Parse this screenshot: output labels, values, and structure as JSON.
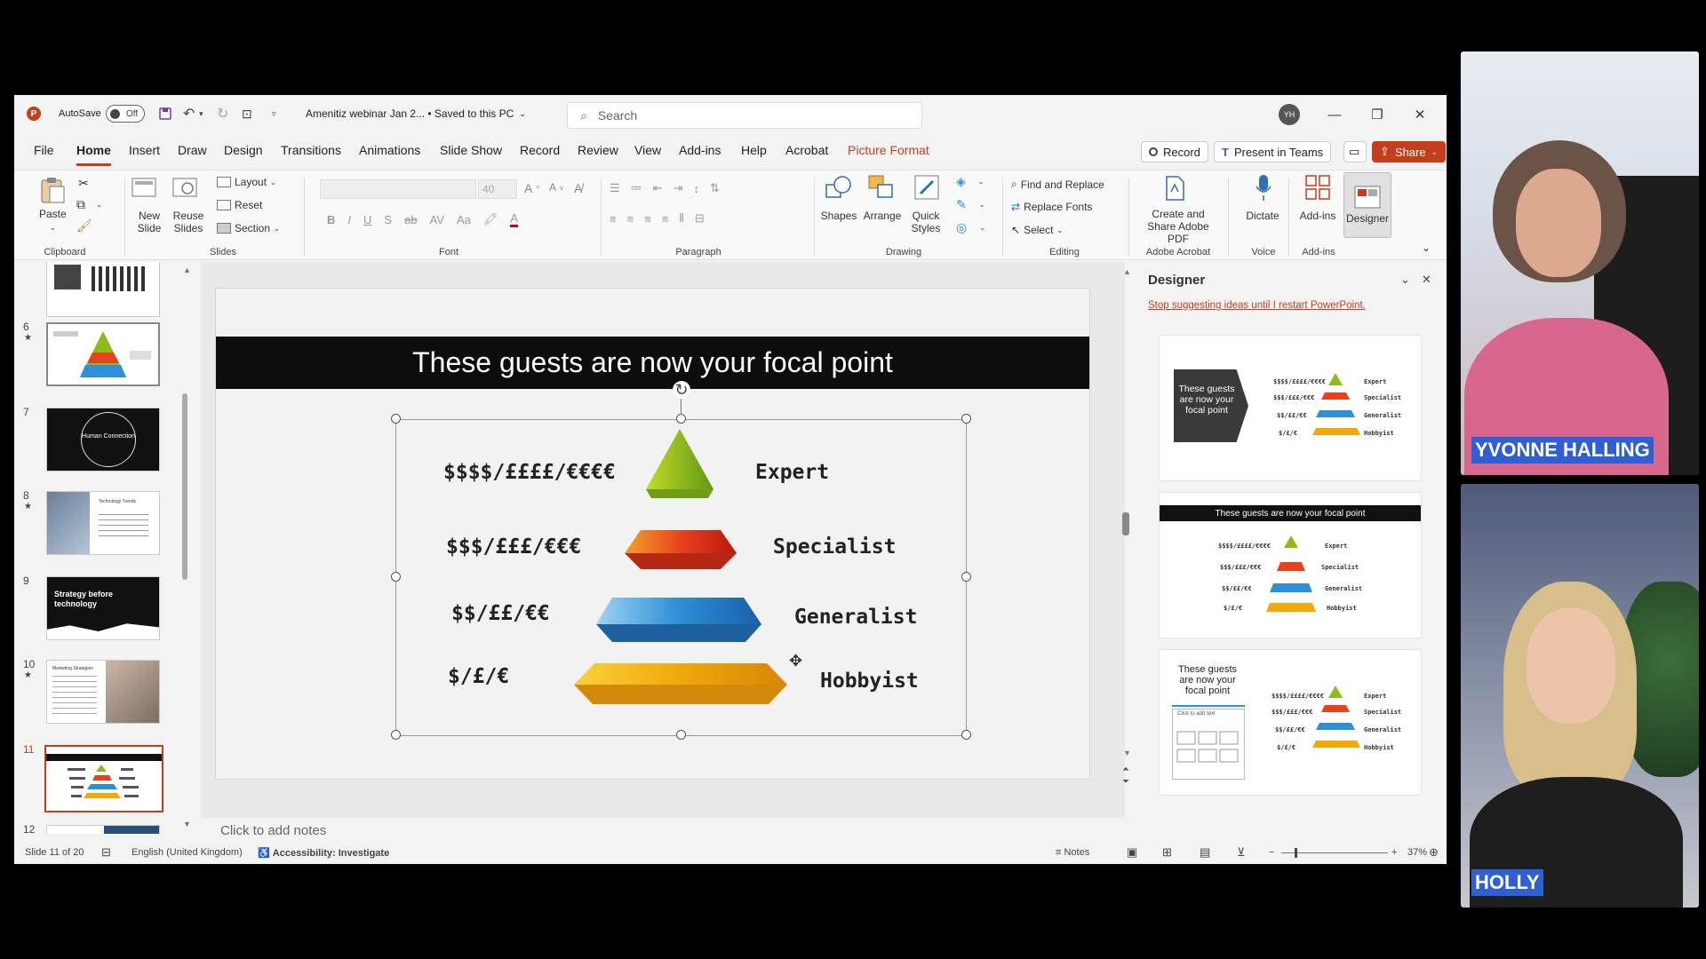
{
  "window": {
    "autosave_label": "AutoSave",
    "autosave_state": "Off",
    "doc_title": "Amenitiz webinar Jan 2... • Saved to this PC",
    "search_placeholder": "Search",
    "avatar_initials": "YH"
  },
  "tabs": [
    "File",
    "Home",
    "Insert",
    "Draw",
    "Design",
    "Transitions",
    "Animations",
    "Slide Show",
    "Record",
    "Review",
    "View",
    "Add-ins",
    "Help",
    "Acrobat",
    "Picture Format"
  ],
  "active_tab": "Home",
  "top_right": {
    "record": "Record",
    "present": "Present in Teams",
    "share": "Share"
  },
  "ribbon": {
    "paste": "Paste",
    "new_slide": "New Slide",
    "reuse_slides": "Reuse Slides",
    "layout": "Layout",
    "reset": "Reset",
    "section": "Section",
    "font_size": "40",
    "shapes": "Shapes",
    "arrange": "Arrange",
    "quick_styles": "Quick Styles",
    "find_replace": "Find and Replace",
    "replace_fonts": "Replace Fonts",
    "select": "Select",
    "create_pdf": "Create and Share Adobe PDF",
    "dictate": "Dictate",
    "addins": "Add-ins",
    "designer": "Designer",
    "groups": {
      "clipboard": "Clipboard",
      "slides": "Slides",
      "font": "Font",
      "paragraph": "Paragraph",
      "drawing": "Drawing",
      "editing": "Editing",
      "adobe": "Adobe Acrobat",
      "voice": "Voice",
      "addins": "Add-ins"
    }
  },
  "thumbnails": [
    {
      "num": "6",
      "star": true,
      "title": ""
    },
    {
      "num": "7",
      "star": false,
      "title": "Human Connection"
    },
    {
      "num": "8",
      "star": true,
      "title": "Technology Trends"
    },
    {
      "num": "9",
      "star": false,
      "title": "Strategy before technology"
    },
    {
      "num": "10",
      "star": true,
      "title": "Marketing Strategies"
    },
    {
      "num": "11",
      "star": false,
      "title": ""
    },
    {
      "num": "12",
      "star": false,
      "title": ""
    }
  ],
  "slide": {
    "title": "These guests are now your focal point",
    "tiers": [
      {
        "price": "$$$$/££££/€€€€",
        "label": "Expert",
        "color": "#8dbb1c"
      },
      {
        "price": "$$$/£££/€€€",
        "label": "Specialist",
        "color": "#e8421c"
      },
      {
        "price": "$$/££/€€",
        "label": "Generalist",
        "color": "#2e8ed6"
      },
      {
        "price": "$/£/€",
        "label": "Hobbyist",
        "color": "#f0a80c"
      }
    ]
  },
  "notes_placeholder": "Click to add notes",
  "designer": {
    "title": "Designer",
    "stop_link": "Stop suggesting ideas until I restart PowerPoint.",
    "card1_title": "These guests are now your focal point",
    "card2_title": "These guests are now your focal point",
    "card3_title": "These guests are now your focal point",
    "card3_sub": "Click to add text"
  },
  "status": {
    "slide_info": "Slide 11 of 20",
    "language": "English (United Kingdom)",
    "accessibility": "Accessibility: Investigate",
    "notes": "Notes",
    "zoom": "37%"
  },
  "participants": [
    {
      "name": "YVONNE HALLING"
    },
    {
      "name": "HOLLY"
    }
  ],
  "colors": {
    "accent": "#c43e1c",
    "name_tag": "#2f5fd0"
  }
}
